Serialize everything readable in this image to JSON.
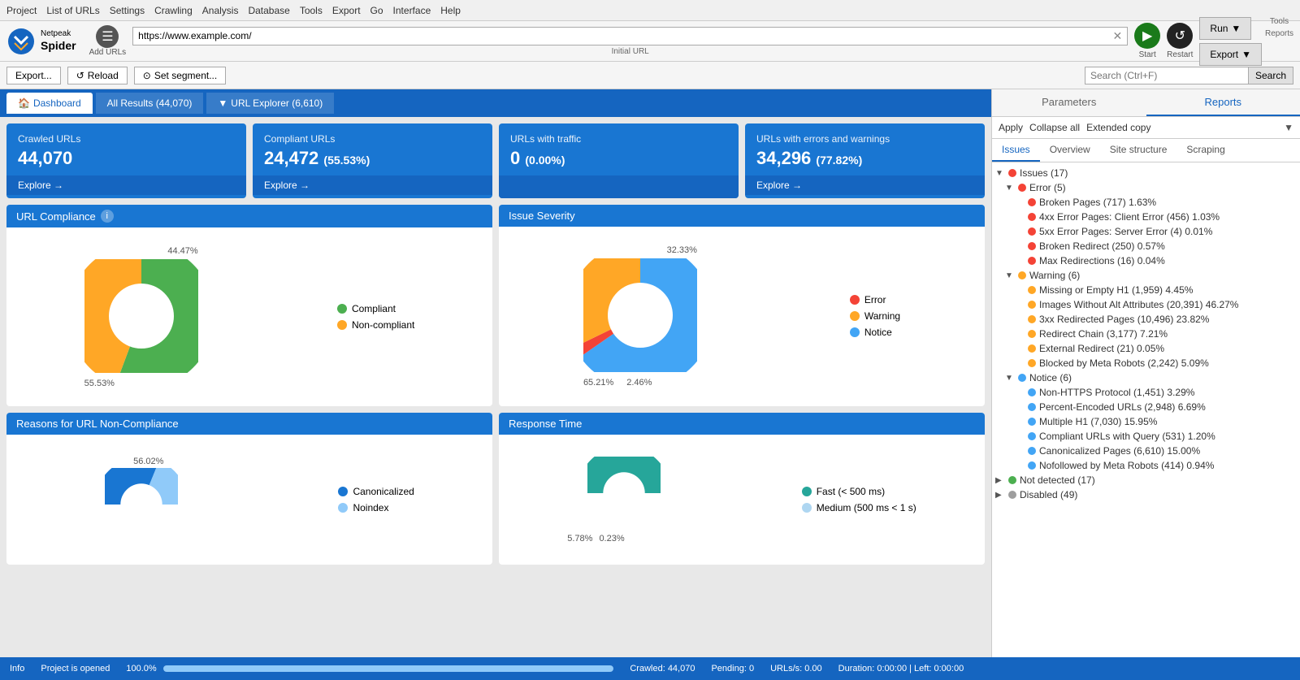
{
  "menu": {
    "items": [
      "Project",
      "List of URLs",
      "Settings",
      "Crawling",
      "Analysis",
      "Database",
      "Tools",
      "Export",
      "Go",
      "Interface",
      "Help"
    ]
  },
  "toolbar": {
    "logo_line1": "Netpeak",
    "logo_line2": "Spider",
    "add_urls_label": "Add URLs",
    "url_value": "https://www.example.com/",
    "url_label": "Initial URL",
    "start_label": "Start",
    "restart_label": "Restart",
    "run_label": "Run",
    "tools_label": "Tools",
    "export_label": "Export",
    "reports_label": "Reports"
  },
  "sec_toolbar": {
    "export_btn": "Export...",
    "reload_btn": "Reload",
    "segment_btn": "Set segment...",
    "search_placeholder": "Search (Ctrl+F)",
    "search_btn": "Search"
  },
  "tabs": {
    "dashboard": "Dashboard",
    "all_results": "All Results (44,070)",
    "url_explorer": "URL Explorer (6,610)"
  },
  "stats": [
    {
      "title": "Crawled URLs",
      "value": "44,070",
      "subtitle": "",
      "explore": "Explore →"
    },
    {
      "title": "Compliant URLs",
      "value": "24,472",
      "subtitle": "(55.53%)",
      "explore": "Explore →"
    },
    {
      "title": "URLs with traffic",
      "value": "0",
      "subtitle": "(0.00%)",
      "explore": ""
    },
    {
      "title": "URLs with errors and warnings",
      "value": "34,296",
      "subtitle": "(77.82%)",
      "explore": "Explore →"
    }
  ],
  "url_compliance": {
    "title": "URL Compliance",
    "pct_55": "55.53%",
    "pct_44": "44.47%",
    "legend": [
      {
        "color": "#4caf50",
        "label": "Compliant"
      },
      {
        "color": "#ffa726",
        "label": "Non-compliant"
      }
    ]
  },
  "issue_severity": {
    "title": "Issue Severity",
    "pct_65": "65.21%",
    "pct_32": "32.33%",
    "pct_2": "2.46%",
    "legend": [
      {
        "color": "#f44336",
        "label": "Error"
      },
      {
        "color": "#ffa726",
        "label": "Warning"
      },
      {
        "color": "#42a5f5",
        "label": "Notice"
      }
    ]
  },
  "non_compliance": {
    "title": "Reasons for URL Non-Compliance",
    "pct_56": "56.02%",
    "legend": [
      {
        "color": "#1976d2",
        "label": "Canonicalized"
      },
      {
        "color": "#90caf9",
        "label": "Noindex"
      }
    ]
  },
  "response_time": {
    "title": "Response Time",
    "pct_5": "5.78%",
    "pct_0": "0.23%",
    "legend": [
      {
        "color": "#26a69a",
        "label": "Fast (< 500 ms)"
      },
      {
        "color": "#aed6f1",
        "label": "Medium (500 ms < 1 s)"
      }
    ]
  },
  "right_panel": {
    "tab_parameters": "Parameters",
    "tab_reports": "Reports",
    "action_apply": "Apply",
    "action_collapse": "Collapse all",
    "action_extended_copy": "Extended copy",
    "issue_tabs": [
      "Issues",
      "Overview",
      "Site structure",
      "Scraping"
    ],
    "issues_tree": [
      {
        "level": 0,
        "expanded": true,
        "arrow": "▼",
        "dot_color": "#f44336",
        "label": "Issues (17)"
      },
      {
        "level": 1,
        "expanded": true,
        "arrow": "▼",
        "dot_color": "#f44336",
        "label": "Error (5)"
      },
      {
        "level": 2,
        "expanded": false,
        "arrow": "",
        "dot_color": "#f44336",
        "label": "Broken Pages (717) 1.63%"
      },
      {
        "level": 2,
        "expanded": false,
        "arrow": "",
        "dot_color": "#f44336",
        "label": "4xx Error Pages: Client Error (456) 1.03%"
      },
      {
        "level": 2,
        "expanded": false,
        "arrow": "",
        "dot_color": "#f44336",
        "label": "5xx Error Pages: Server Error (4) 0.01%"
      },
      {
        "level": 2,
        "expanded": false,
        "arrow": "",
        "dot_color": "#f44336",
        "label": "Broken Redirect (250) 0.57%"
      },
      {
        "level": 2,
        "expanded": false,
        "arrow": "",
        "dot_color": "#f44336",
        "label": "Max Redirections (16) 0.04%"
      },
      {
        "level": 1,
        "expanded": true,
        "arrow": "▼",
        "dot_color": "#ffa726",
        "label": "Warning (6)"
      },
      {
        "level": 2,
        "expanded": false,
        "arrow": "",
        "dot_color": "#ffa726",
        "label": "Missing or Empty H1 (1,959) 4.45%"
      },
      {
        "level": 2,
        "expanded": false,
        "arrow": "",
        "dot_color": "#ffa726",
        "label": "Images Without Alt Attributes (20,391) 46.27%"
      },
      {
        "level": 2,
        "expanded": false,
        "arrow": "",
        "dot_color": "#ffa726",
        "label": "3xx Redirected Pages (10,496) 23.82%"
      },
      {
        "level": 2,
        "expanded": false,
        "arrow": "",
        "dot_color": "#ffa726",
        "label": "Redirect Chain (3,177) 7.21%"
      },
      {
        "level": 2,
        "expanded": false,
        "arrow": "",
        "dot_color": "#ffa726",
        "label": "External Redirect (21) 0.05%"
      },
      {
        "level": 2,
        "expanded": false,
        "arrow": "",
        "dot_color": "#ffa726",
        "label": "Blocked by Meta Robots (2,242) 5.09%"
      },
      {
        "level": 1,
        "expanded": true,
        "arrow": "▼",
        "dot_color": "#42a5f5",
        "label": "Notice (6)"
      },
      {
        "level": 2,
        "expanded": false,
        "arrow": "",
        "dot_color": "#42a5f5",
        "label": "Non-HTTPS Protocol (1,451) 3.29%"
      },
      {
        "level": 2,
        "expanded": false,
        "arrow": "",
        "dot_color": "#42a5f5",
        "label": "Percent-Encoded URLs (2,948) 6.69%"
      },
      {
        "level": 2,
        "expanded": false,
        "arrow": "",
        "dot_color": "#42a5f5",
        "label": "Multiple H1 (7,030) 15.95%"
      },
      {
        "level": 2,
        "expanded": false,
        "arrow": "",
        "dot_color": "#42a5f5",
        "label": "Compliant URLs with Query (531) 1.20%"
      },
      {
        "level": 2,
        "expanded": false,
        "arrow": "",
        "dot_color": "#42a5f5",
        "label": "Canonicalized Pages (6,610) 15.00%"
      },
      {
        "level": 2,
        "expanded": false,
        "arrow": "",
        "dot_color": "#42a5f5",
        "label": "Nofollowed by Meta Robots (414) 0.94%"
      },
      {
        "level": 0,
        "expanded": false,
        "arrow": "▶",
        "dot_color": "#4caf50",
        "label": "Not detected (17)"
      },
      {
        "level": 0,
        "expanded": false,
        "arrow": "▶",
        "dot_color": "#9e9e9e",
        "label": "Disabled (49)"
      }
    ]
  },
  "status_bar": {
    "info": "Info",
    "project_status": "Project is opened",
    "progress_pct": "100.0%",
    "progress_val": 100,
    "crawled": "Crawled: 44,070",
    "pending": "Pending: 0",
    "urls_per_sec": "URLs/s: 0.00",
    "duration": "Duration: 0:00:00 | Left: 0:00:00"
  }
}
